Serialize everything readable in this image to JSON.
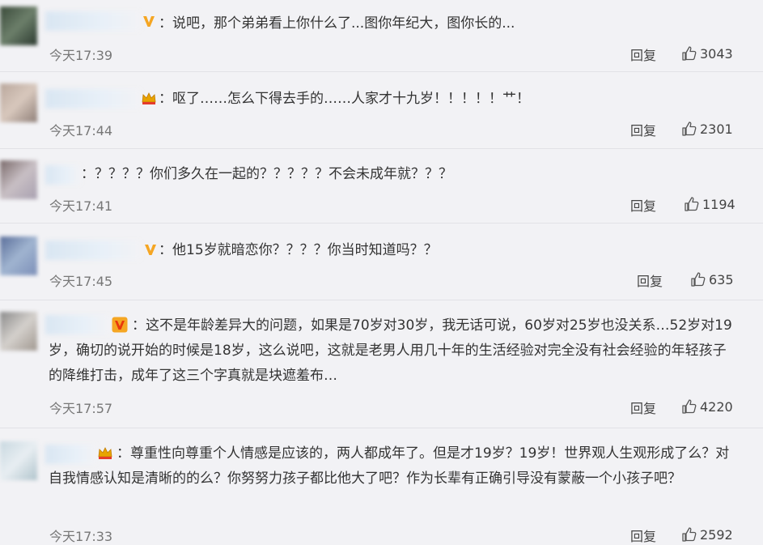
{
  "colors": {
    "background": "#f2f2f5",
    "text": "#333333",
    "muted": "#777777",
    "v_badge": "#f5a623",
    "v_badge_red": "#e8380d",
    "crown": "#e8a300"
  },
  "comments": [
    {
      "badge": "v-icon",
      "text": "：说吧，那个弟弟看上你什么了...图你年纪大，图你长的...",
      "time": "今天17:39",
      "reply": "回复",
      "likes": "3043"
    },
    {
      "badge": "crown-icon",
      "text": "：呕了……怎么下得去手的……人家才十九岁！！！！！艹！",
      "time": "今天17:44",
      "reply": "回复",
      "likes": "2301"
    },
    {
      "badge": "",
      "text": "：？？？？你们多久在一起的？？？？？不会未成年就？？？",
      "time": "今天17:41",
      "reply": "回复",
      "likes": "1194"
    },
    {
      "badge": "v-icon",
      "text": "：他15岁就暗恋你？？？？你当时知道吗？？",
      "time": "今天17:45",
      "reply": "回复",
      "likes": "635"
    },
    {
      "badge": "v-red-icon",
      "text": "：这不是年龄差异大的问题，如果是70岁对30岁，我无话可说，60岁对25岁也没关系…52岁对19岁，确切的说开始的时候是18岁，这么说吧，这就是老男人用几十年的生活经验对完全没有社会经验的年轻孩子的降维打击，成年了这三个字真就是块遮羞布…",
      "time": "今天17:57",
      "reply": "回复",
      "likes": "4220"
    },
    {
      "badge": "crown-icon",
      "text": "：尊重性向尊重个人情感是应该的，两人都成年了。但是才19岁？19岁！世界观人生观形成了么？对自我情感认知是清晰的的么？你努努力孩子都比他大了吧？作为长辈有正确引导没有蒙蔽一个小孩子吧？",
      "time": "今天17:33",
      "reply": "回复",
      "likes": "2592"
    }
  ]
}
